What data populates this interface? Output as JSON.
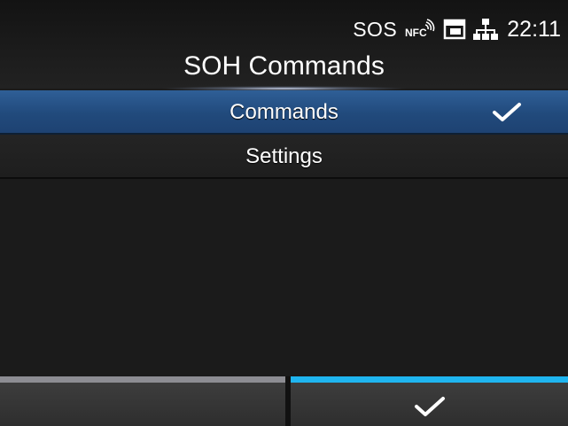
{
  "status_bar": {
    "sos_label": "SOS",
    "nfc_label": "NFC",
    "icons": [
      "nfc-icon",
      "storage-card-icon",
      "network-icon"
    ],
    "time": "22:11"
  },
  "screen": {
    "title": "SOH Commands"
  },
  "menu": {
    "items": [
      {
        "label": "Commands",
        "selected": true,
        "checked": true
      },
      {
        "label": "Settings",
        "selected": false,
        "checked": false
      }
    ]
  },
  "softkeys": {
    "left": {
      "icon": null
    },
    "right": {
      "icon": "checkmark-icon"
    }
  },
  "colors": {
    "selection_blue": "#214a7c",
    "right_softkey_accent": "#1fb5f0",
    "left_softkey_accent": "#8d8d93",
    "background": "#1b1b1b"
  }
}
